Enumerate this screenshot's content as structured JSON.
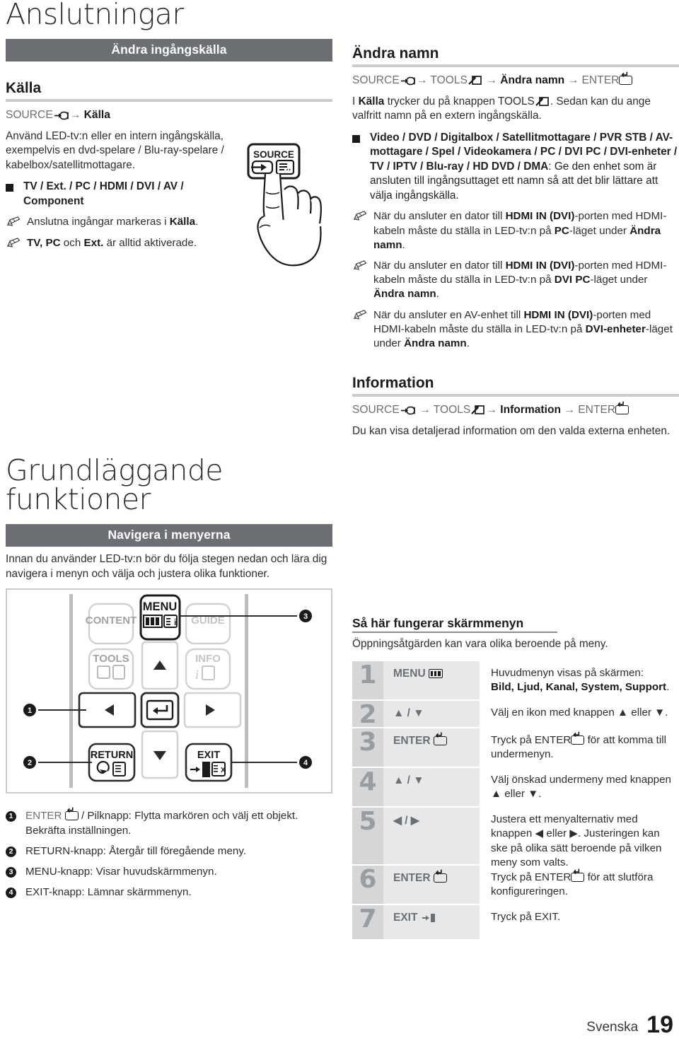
{
  "page": {
    "language_label": "Svenska",
    "page_number": "19",
    "bar_color": "#6c6f73",
    "rule_color": "#c9cbcd"
  },
  "chapter1": {
    "title": "Anslutningar",
    "bar_label": "Ändra ingångskälla",
    "source_section": {
      "heading": "Källa",
      "nav_path_prefix": "SOURCE",
      "nav_path_arrow": "→",
      "nav_path_target": "Källa",
      "intro": "Använd LED-tv:n eller en intern ingångskälla, exempelvis en dvd-spelare / Blu-ray-spelare / kabelbox/satellitmottagare.",
      "option_list": "TV / Ext. / PC / HDMI / DVI / AV / Component",
      "notes": [
        "Anslutna ingångar markeras i Källa.",
        "TV, PC och Ext. är alltid aktiverade."
      ],
      "note0_bold": "Källa",
      "note1_bold_a": "TV, PC",
      "note1_mid": " och ",
      "note1_bold_b": "Ext.",
      "note1_tail": " är alltid aktiverade.",
      "art_label": "SOURCE"
    },
    "rename_section": {
      "heading": "Ändra namn",
      "path_source": "SOURCE",
      "path_tools": "TOOLS",
      "path_item": "Ändra namn",
      "path_enter": "ENTER",
      "intro_a": "I ",
      "intro_kalla": "Källa",
      "intro_b": " trycker du på knappen TOOLS",
      "intro_c": ". Sedan kan du ange valfritt namn på en extern ingångskälla.",
      "device_list_bold": "Video / DVD / Digitalbox / Satellitmottagare / PVR STB / AV-mottagare / Spel / Videokamera / PC / DVI PC / DVI-enheter / TV / IPTV / Blu-ray / HD DVD / DMA",
      "device_list_tail": ": Ge den enhet som är ansluten till ingångsuttaget ett namn så att det blir lättare att välja ingångskälla.",
      "notes": [
        {
          "a": "När du ansluter en dator till ",
          "b": "HDMI IN (DVI)",
          "c": "-porten med HDMI-kabeln måste du ställa in LED-tv:n på ",
          "d": "PC",
          "e": "-läget under ",
          "f": "Ändra namn",
          "g": "."
        },
        {
          "a": "När du ansluter en dator till ",
          "b": "HDMI IN (DVI)",
          "c": "-porten med HDMI-kabeln måste du ställa in LED-tv:n på ",
          "d": "DVI PC",
          "e": "-läget under ",
          "f": "Ändra namn",
          "g": "."
        },
        {
          "a": "När du ansluter en AV-enhet till ",
          "b": "HDMI IN (DVI)",
          "c": "-porten med HDMI-kabeln måste du ställa in LED-tv:n på ",
          "d": "DVI-enheter",
          "e": "-läget under ",
          "f": "Ändra namn",
          "g": "."
        }
      ]
    },
    "information_section": {
      "heading": "Information",
      "path_source": "SOURCE",
      "path_tools": "TOOLS",
      "path_item": "Information",
      "path_enter": "ENTER",
      "body": "Du kan visa detaljerad information om den valda externa enheten."
    }
  },
  "chapter2": {
    "title": "Grundläggande funktioner",
    "bar_label": "Navigera i menyerna",
    "intro": "Innan du använder LED-tv:n bör du följa stegen nedan och lära dig navigera i menyn och välja och justera olika funktioner.",
    "remote_buttons": {
      "content": "CONTENT",
      "menu": "MENU",
      "guide": "GUIDE",
      "tools": "TOOLS",
      "info": "INFO",
      "return": "RETURN",
      "exit": "EXIT"
    },
    "callouts": [
      "1",
      "2",
      "3",
      "4"
    ],
    "legend": [
      {
        "num": "1",
        "a": "ENTER",
        "b": " / Pilknapp: Flytta markören och välj ett objekt. Bekräfta inställningen."
      },
      {
        "num": "2",
        "a": "",
        "b": "RETURN-knapp: Återgår till föregående meny."
      },
      {
        "num": "3",
        "a": "",
        "b": "MENU-knapp: Visar huvudskärmmenyn."
      },
      {
        "num": "4",
        "a": "",
        "b": "EXIT-knapp: Lämnar skärmmenyn."
      }
    ],
    "osd_section": {
      "heading": "Så här fungerar skärmmenyn",
      "subtitle": "Öppningsåtgärden kan vara olika beroende på meny.",
      "steps": [
        {
          "num": "1",
          "key": "MENU",
          "key_icon": "menu-icon",
          "desc_a": "Huvudmenyn visas på skärmen:",
          "desc_bold": "Bild, Ljud, Kanal, System, Support",
          "desc_tail": "."
        },
        {
          "num": "2",
          "key": "▲ / ▼",
          "key_icon": "",
          "desc_a": "Välj en ikon med knappen ▲ eller ▼.",
          "desc_bold": "",
          "desc_tail": ""
        },
        {
          "num": "3",
          "key": "ENTER",
          "key_icon": "enter-icon",
          "desc_a": "Tryck på ENTER",
          "desc_bold": "",
          "desc_tail": " för att komma till undermenyn."
        },
        {
          "num": "4",
          "key": "▲ / ▼",
          "key_icon": "",
          "desc_a": "Välj önskad undermeny med knappen ▲ eller ▼.",
          "desc_bold": "",
          "desc_tail": ""
        },
        {
          "num": "5",
          "key": "◀ / ▶",
          "key_icon": "",
          "desc_a": "Justera ett menyalternativ med knappen ◀ eller ▶. Justeringen kan ske på olika sätt beroende på vilken meny som valts.",
          "desc_bold": "",
          "desc_tail": ""
        },
        {
          "num": "6",
          "key": "ENTER",
          "key_icon": "enter-icon",
          "desc_a": "Tryck på ENTER",
          "desc_bold": "",
          "desc_tail": " för att slutföra konfigureringen."
        },
        {
          "num": "7",
          "key": "EXIT",
          "key_icon": "exit-icon",
          "desc_a": "Tryck på EXIT.",
          "desc_bold": "",
          "desc_tail": ""
        }
      ]
    }
  }
}
